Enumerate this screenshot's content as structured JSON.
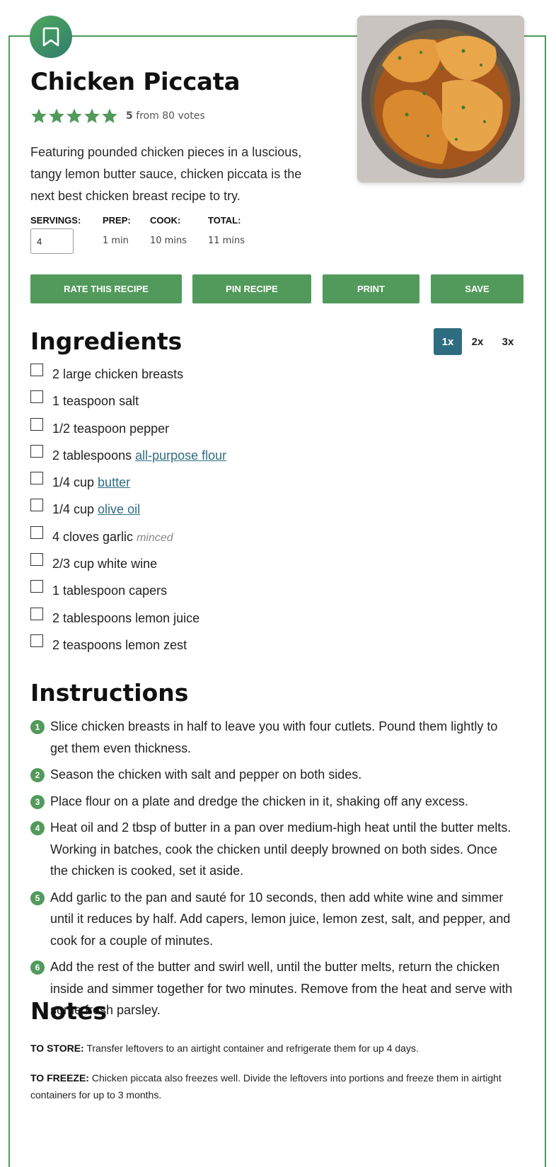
{
  "recipe": {
    "title": "Chicken Piccata",
    "rating": {
      "score": "5",
      "suffix": "from 80 votes",
      "stars": 5
    },
    "summary": "Featuring pounded chicken pieces in a luscious, tangy lemon butter sauce, chicken piccata is the next best chicken breast recipe to try.",
    "meta": {
      "servings_label": "SERVINGS:",
      "servings_value": "4",
      "prep_label": "PREP:",
      "prep_value": "1 min",
      "cook_label": "COOK:",
      "cook_value": "10 mins",
      "total_label": "TOTAL:",
      "total_value": "11 mins"
    },
    "buttons": {
      "rate": "RATE THIS RECIPE",
      "pin": "PIN RECIPE",
      "print": "PRINT",
      "save": "SAVE"
    },
    "bookmark_icon": "bookmark-icon",
    "colors": {
      "accent": "#529a5b",
      "multiplier_active": "#2e6d80",
      "link": "#2e6d80"
    }
  },
  "ingredients": {
    "heading": "Ingredients",
    "multipliers": [
      "1x",
      "2x",
      "3x"
    ],
    "active_multiplier": "1x",
    "items": [
      {
        "text": "2 large chicken breasts"
      },
      {
        "text": "1 teaspoon salt"
      },
      {
        "text": "1/2 teaspoon pepper"
      },
      {
        "text": "2 tablespoons ",
        "link": "all-purpose flour"
      },
      {
        "text": "1/4 cup ",
        "link": "butter"
      },
      {
        "text": "1/4 cup ",
        "link": "olive oil"
      },
      {
        "text": "4 cloves garlic ",
        "note": "minced"
      },
      {
        "text": "2/3 cup white wine"
      },
      {
        "text": "1 tablespoon capers"
      },
      {
        "text": "2 tablespoons lemon juice"
      },
      {
        "text": "2 teaspoons lemon zest"
      }
    ]
  },
  "instructions": {
    "heading": "Instructions",
    "steps": [
      {
        "num": "1",
        "text": "Slice chicken breasts in half to leave you with four cutlets. Pound them lightly to get them even thickness."
      },
      {
        "num": "2",
        "text": "Season the chicken with salt and pepper on both sides."
      },
      {
        "num": "3",
        "text": "Place flour on a plate and dredge the chicken in it, shaking off any excess."
      },
      {
        "num": "4",
        "text": "Heat oil and 2 tbsp of butter in a pan over medium-high heat until the butter melts. Working in batches, cook the chicken until deeply browned on both sides. Once the chicken is cooked, set it aside."
      },
      {
        "num": "5",
        "text": "Add garlic to the pan and sauté for 10 seconds, then add white wine and simmer until it reduces by half. Add capers, lemon juice, lemon zest, salt, and pepper, and cook for a couple of minutes."
      },
      {
        "num": "6",
        "text": "Add the rest of the butter and swirl well, until the butter melts, return the chicken inside and simmer together for two minutes. Remove from the heat and serve with some fresh parsley."
      }
    ]
  },
  "notes": {
    "heading": "Notes",
    "items": [
      {
        "label": "TO STORE:",
        "text": "Transfer leftovers to an airtight container and refrigerate them for up 4 days."
      },
      {
        "label": "TO FREEZE:",
        "text": "Chicken piccata also freezes well. Divide the leftovers into portions and freeze them in airtight containers for up to 3 months."
      }
    ]
  }
}
